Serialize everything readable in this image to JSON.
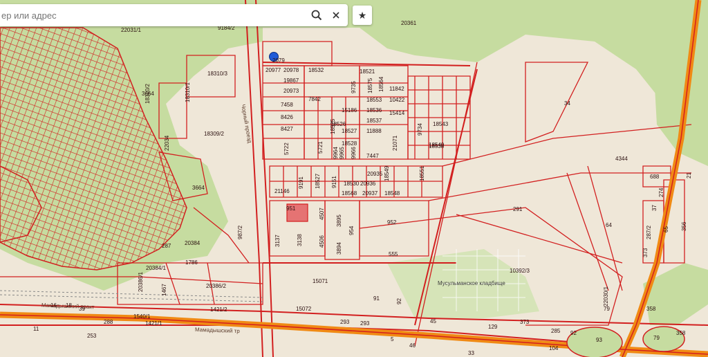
{
  "search": {
    "placeholder": "ер или адрес",
    "search_icon": "search-icon",
    "clear_icon": "close-icon"
  },
  "favorites": {
    "icon": "star-icon",
    "glyph": "★"
  },
  "map": {
    "colors": {
      "background": "#efe7d8",
      "forest": "#c6dca0",
      "parcel_line": "#d21f1f",
      "highway": "#f08a14",
      "highlight_parcel": "#e57373"
    },
    "cemetery_label": "Мусульманское кладбище",
    "road_labels": [
      "Мамадышский тракт",
      "Мамадышский тр",
      "Чорный проезд"
    ],
    "parcels": [
      "22031/1",
      "9184/2",
      "20361",
      "18310/3",
      "3664",
      "18310/2",
      "18310/1",
      "18309/2",
      "22034",
      "3664",
      "20977",
      "20978",
      "2079",
      "18532",
      "18521",
      "19867",
      "9735",
      "18575",
      "18564",
      "11842",
      "20973",
      "7842",
      "18553",
      "10422",
      "7458",
      "15186",
      "18536",
      "15414",
      "34",
      "8426",
      "18526",
      "18537",
      "18543",
      "8427",
      "18525",
      "11888",
      "9734",
      "5722",
      "18527",
      "21071",
      "18538",
      "18540",
      "5721",
      "9964",
      "9965",
      "18528",
      "9966",
      "7447",
      "4344",
      "9191",
      "18527",
      "20935",
      "18549",
      "18551",
      "9151",
      "18530",
      "20936",
      "21146",
      "18568",
      "20937",
      "18548",
      "688",
      "951",
      "4507",
      "291",
      "274",
      "21",
      "3895",
      "952",
      "64",
      "37",
      "954",
      "356",
      "987/2",
      "3137",
      "3138",
      "4506",
      "287/2",
      "3894",
      "555",
      "65",
      "287",
      "20384",
      "20384/1",
      "1786",
      "373",
      "10392/3",
      "20386/1",
      "20386/2",
      "15071",
      "92",
      "22030/1",
      "1467",
      "1421/2",
      "15072",
      "91",
      "79",
      "358",
      "16",
      "18",
      "39",
      "293",
      "45",
      "373",
      "1540/1",
      "288",
      "293",
      "129",
      "1421/1",
      "11",
      "253",
      "285",
      "92",
      "5",
      "46",
      "104",
      "93",
      "79",
      "358",
      "33"
    ]
  }
}
